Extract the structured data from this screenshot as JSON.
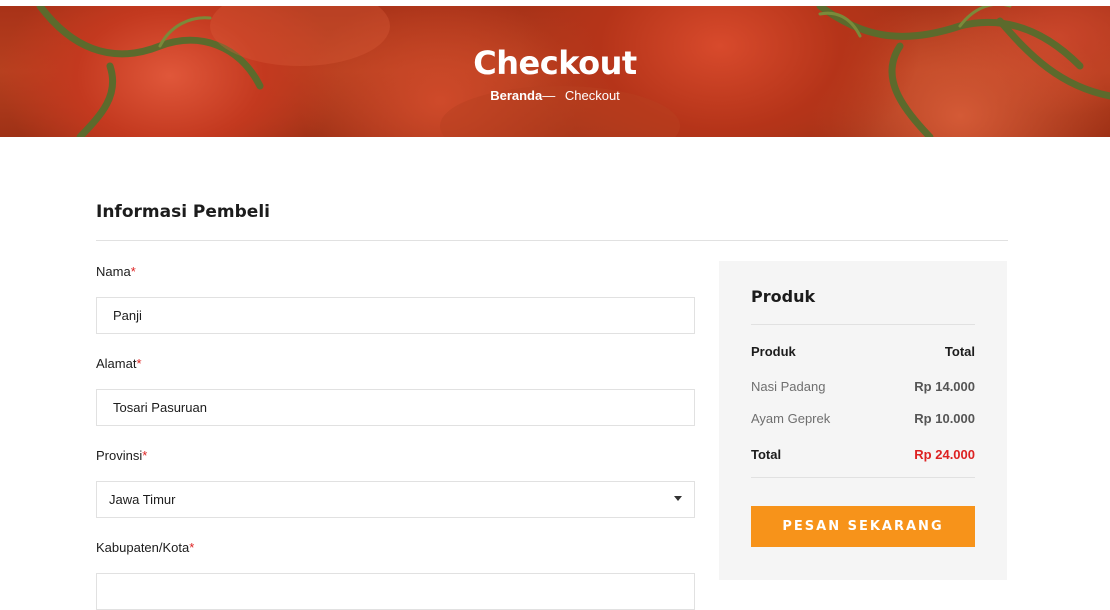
{
  "hero": {
    "title": "Checkout",
    "breadcrumb_home": "Beranda",
    "breadcrumb_sep": "—",
    "breadcrumb_current": "Checkout"
  },
  "buyer": {
    "section_title": "Informasi Pembeli",
    "fields": [
      {
        "label": "Nama",
        "required": "*",
        "value": "Panji"
      },
      {
        "label": "Alamat",
        "required": "*",
        "value": "Tosari Pasuruan"
      },
      {
        "label": "Provinsi",
        "required": "*",
        "value": "Jawa Timur"
      },
      {
        "label": "Kabupaten/Kota",
        "required": "*",
        "value": ""
      }
    ]
  },
  "order": {
    "title": "Produk",
    "header_product": "Produk",
    "header_total": "Total",
    "items": [
      {
        "name": "Nasi Padang",
        "price": "Rp 14.000"
      },
      {
        "name": "Ayam Geprek",
        "price": "Rp 10.000"
      }
    ],
    "total_label": "Total",
    "total_value": "Rp 24.000",
    "button_label": "PESAN SEKARANG"
  },
  "colors": {
    "accent": "#f7931a",
    "required": "#dd2222",
    "total_price": "#dd2222",
    "panel_bg": "#f5f5f5"
  }
}
